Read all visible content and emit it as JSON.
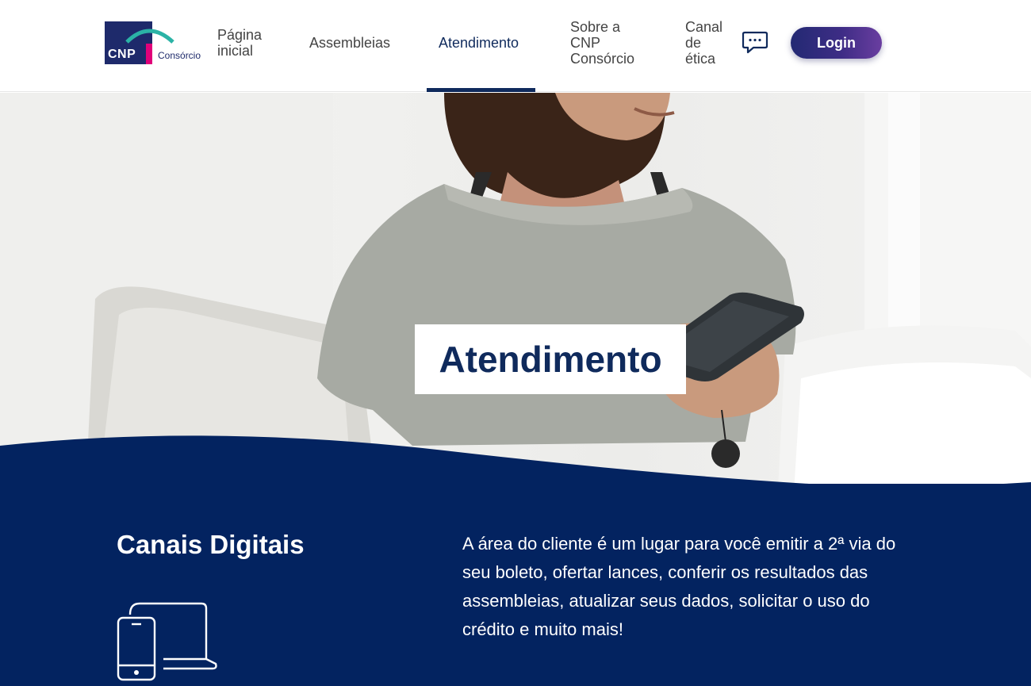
{
  "header": {
    "logo": {
      "brand": "CNP",
      "sub": "Consórcio"
    },
    "nav": [
      {
        "label_line1": "Página",
        "label_line2": "inicial",
        "label_line3": ""
      },
      {
        "label_line1": "Assembleias",
        "label_line2": "",
        "label_line3": ""
      },
      {
        "label_line1": "Atendimento",
        "label_line2": "",
        "label_line3": ""
      },
      {
        "label_line1": "Sobre a",
        "label_line2": "CNP",
        "label_line3": "Consórcio"
      },
      {
        "label_line1": "Canal",
        "label_line2": "de",
        "label_line3": "ética"
      }
    ],
    "active_nav": "Atendimento",
    "chat_icon": "chat-bubble-icon",
    "login_label": "Login"
  },
  "hero": {
    "title": "Atendimento"
  },
  "section": {
    "title": "Canais Digitais",
    "text": "A área do cliente é um lugar para você emitir a 2ª via do seu boleto, ofertar lances, conferir os resultados das assembleias, atualizar seus dados, solicitar o uso do crédito e muito mais!",
    "icon": "devices-icon"
  },
  "colors": {
    "brand_navy": "#0f2a5c",
    "section_bg": "#032360",
    "login_gradient_start": "#232a73",
    "login_gradient_end": "#6a3ea0",
    "logo_pink": "#e0007a",
    "logo_teal": "#2bb3a6"
  }
}
